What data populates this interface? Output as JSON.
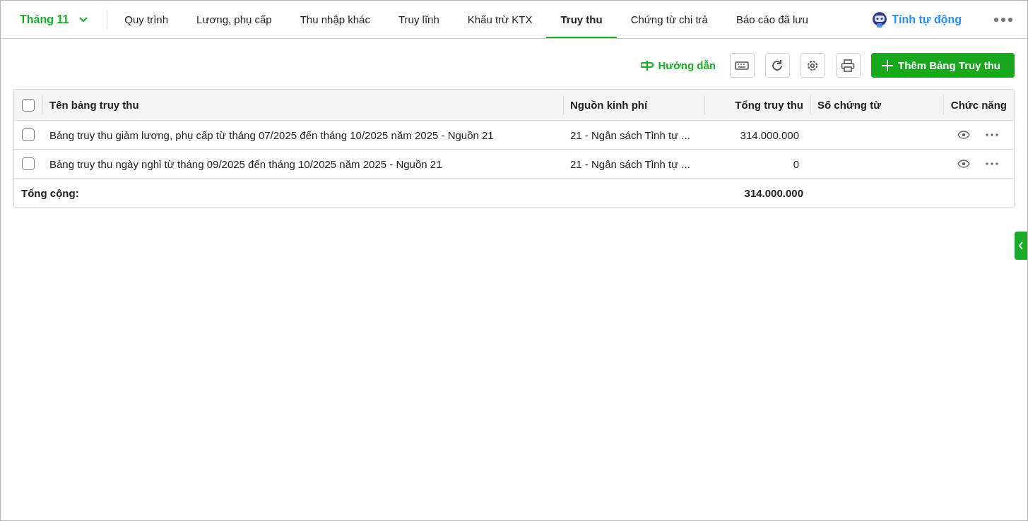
{
  "month_picker": {
    "label": "Tháng 11"
  },
  "tabs": [
    {
      "label": "Quy trình",
      "selected": false
    },
    {
      "label": "Lương, phụ cấp",
      "selected": false
    },
    {
      "label": "Thu nhập khác",
      "selected": false
    },
    {
      "label": "Truy lĩnh",
      "selected": false
    },
    {
      "label": "Khấu trừ KTX",
      "selected": false
    },
    {
      "label": "Truy thu",
      "selected": true
    },
    {
      "label": "Chứng từ chi trả",
      "selected": false
    },
    {
      "label": "Báo cáo đã lưu",
      "selected": false
    }
  ],
  "auto_calc": {
    "label": "Tính tự động"
  },
  "toolbar": {
    "guide_link": "Hướng dẫn",
    "add_button": "Thêm Bảng Truy thu"
  },
  "table": {
    "select_all_checked": false,
    "columns": [
      "Tên bảng truy thu",
      "Nguồn kinh phí",
      "Tổng truy thu",
      "Số chứng từ",
      "Chức năng"
    ],
    "rows": [
      {
        "checked": false,
        "name": "Bảng truy thu giảm lương, phụ cấp từ tháng 07/2025 đến tháng 10/2025 năm 2025 - Nguồn 21",
        "source": "21 - Ngân sách Tỉnh tự ...",
        "total": "314.000.000"
      },
      {
        "checked": false,
        "name": "Bảng truy thu ngày nghỉ từ tháng 09/2025 đến tháng 10/2025 năm 2025 - Nguồn 21",
        "source": "21 - Ngân sách Tỉnh tự ...",
        "total": "0"
      }
    ],
    "footer": {
      "label": "Tổng cộng:",
      "total": "314.000.000"
    }
  }
}
